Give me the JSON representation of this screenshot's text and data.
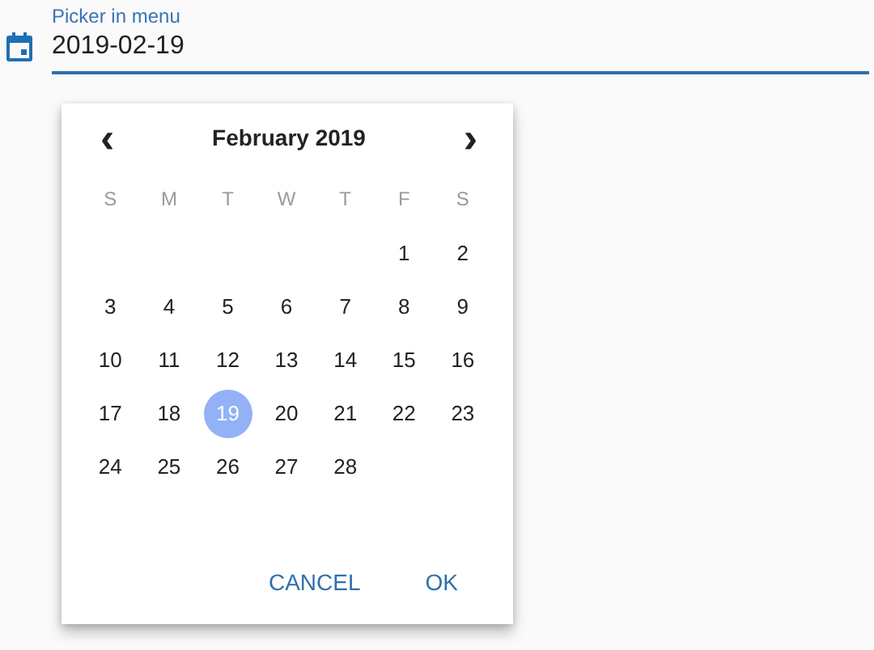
{
  "field": {
    "label": "Picker in menu",
    "value": "2019-02-19"
  },
  "picker": {
    "month": "February 2019",
    "prev": "‹",
    "next": "›",
    "weekdays": [
      "S",
      "M",
      "T",
      "W",
      "T",
      "F",
      "S"
    ],
    "weeks": [
      {
        "kind": "first",
        "days": [
          {
            "day": "1",
            "selected": false
          },
          {
            "day": "2",
            "selected": false
          }
        ]
      },
      {
        "kind": "full",
        "days": [
          {
            "day": "3",
            "selected": false
          },
          {
            "day": "4",
            "selected": false
          },
          {
            "day": "5",
            "selected": false
          },
          {
            "day": "6",
            "selected": false
          },
          {
            "day": "7",
            "selected": false
          },
          {
            "day": "8",
            "selected": false
          },
          {
            "day": "9",
            "selected": false
          }
        ]
      },
      {
        "kind": "full",
        "days": [
          {
            "day": "10",
            "selected": false
          },
          {
            "day": "11",
            "selected": false
          },
          {
            "day": "12",
            "selected": false
          },
          {
            "day": "13",
            "selected": false
          },
          {
            "day": "14",
            "selected": false
          },
          {
            "day": "15",
            "selected": false
          },
          {
            "day": "16",
            "selected": false
          }
        ]
      },
      {
        "kind": "full",
        "days": [
          {
            "day": "17",
            "selected": false
          },
          {
            "day": "18",
            "selected": false
          },
          {
            "day": "19",
            "selected": true
          },
          {
            "day": "20",
            "selected": false
          },
          {
            "day": "21",
            "selected": false
          },
          {
            "day": "22",
            "selected": false
          },
          {
            "day": "23",
            "selected": false
          }
        ]
      },
      {
        "kind": "last",
        "days": [
          {
            "day": "24",
            "selected": false
          },
          {
            "day": "25",
            "selected": false
          },
          {
            "day": "26",
            "selected": false
          },
          {
            "day": "27",
            "selected": false
          },
          {
            "day": "28",
            "selected": false
          }
        ]
      }
    ],
    "buttons": [
      "CANCEL",
      "OK"
    ]
  }
}
